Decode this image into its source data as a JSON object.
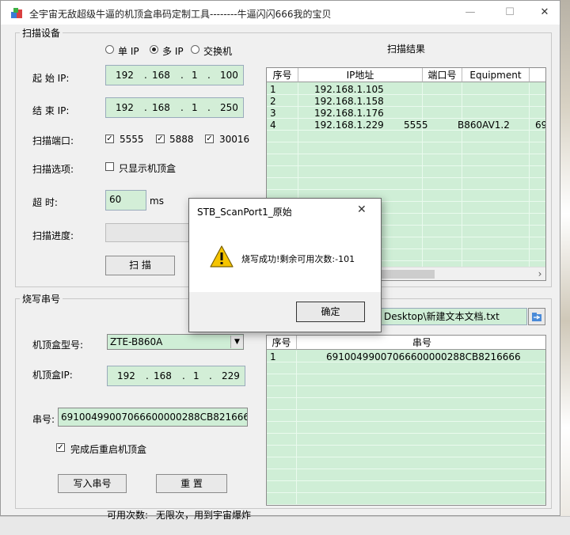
{
  "window": {
    "title": "全宇宙无敌超级牛逼的机顶盒串码定制工具--------牛逼闪闪666我的宝贝",
    "minimize": "—",
    "maximize": "☐",
    "close": "✕"
  },
  "scan": {
    "group_title": "扫描设备",
    "mode_single": "单 IP",
    "mode_multi": "多 IP",
    "mode_switch": "交换机",
    "start_ip_label": "起  始 IP:",
    "start_ip": [
      "192",
      ".",
      "168",
      ".",
      "1",
      ".",
      "100"
    ],
    "end_ip_label": "结  束 IP:",
    "end_ip": [
      "192",
      ".",
      "168",
      ".",
      "1",
      ".",
      "250"
    ],
    "port_label": "扫描端口:",
    "ports": [
      "5555",
      "5888",
      "30016"
    ],
    "option_label": "扫描选项:",
    "option_text": "只显示机顶盒",
    "timeout_label": "超      时:",
    "timeout_value": "60",
    "timeout_unit": "ms",
    "progress_label": "扫描进度:",
    "scan_button": "扫    描"
  },
  "results": {
    "title": "扫描结果",
    "columns": [
      "序号",
      "IP地址",
      "端口号",
      "Equipment"
    ],
    "rows": [
      [
        "1",
        "192.168.1.105",
        "",
        "",
        ""
      ],
      [
        "2",
        "192.168.1.158",
        "",
        "",
        ""
      ],
      [
        "3",
        "192.168.1.176",
        "",
        "",
        ""
      ],
      [
        "4",
        "192.168.1.229",
        "5555",
        "B860AV1.2",
        "69"
      ]
    ],
    "scroll_right": "›"
  },
  "burn": {
    "group_title": "烧写串号",
    "file_path": "Desktop\\新建文本文档.txt",
    "model_label": "机顶盒型号:",
    "model_value": "ZTE-B860A",
    "ip_label": "机顶盒IP:",
    "ip": [
      "192",
      ".",
      "168",
      ".",
      "1",
      ".",
      "229"
    ],
    "serial_label": "串号:",
    "serial_value": "69100499007066600000288CB8216666",
    "reboot_text": "完成后重启机顶盒",
    "write_button": "写入串号",
    "reset_button": "重    置",
    "quota_label": "可用次数:",
    "quota_value": "无限次，用到宇宙爆炸",
    "list_columns": [
      "序号",
      "串号"
    ],
    "list_rows": [
      [
        "1",
        "69100499007066600000288CB8216666"
      ]
    ]
  },
  "dialog": {
    "title": "STB_ScanPort1_原始",
    "message": "烧写成功!剩余可用次数:-101",
    "ok": "确定",
    "close": "✕"
  },
  "colors": {
    "field_green": "#cfeed6",
    "warning_yellow": "#f5c400"
  }
}
